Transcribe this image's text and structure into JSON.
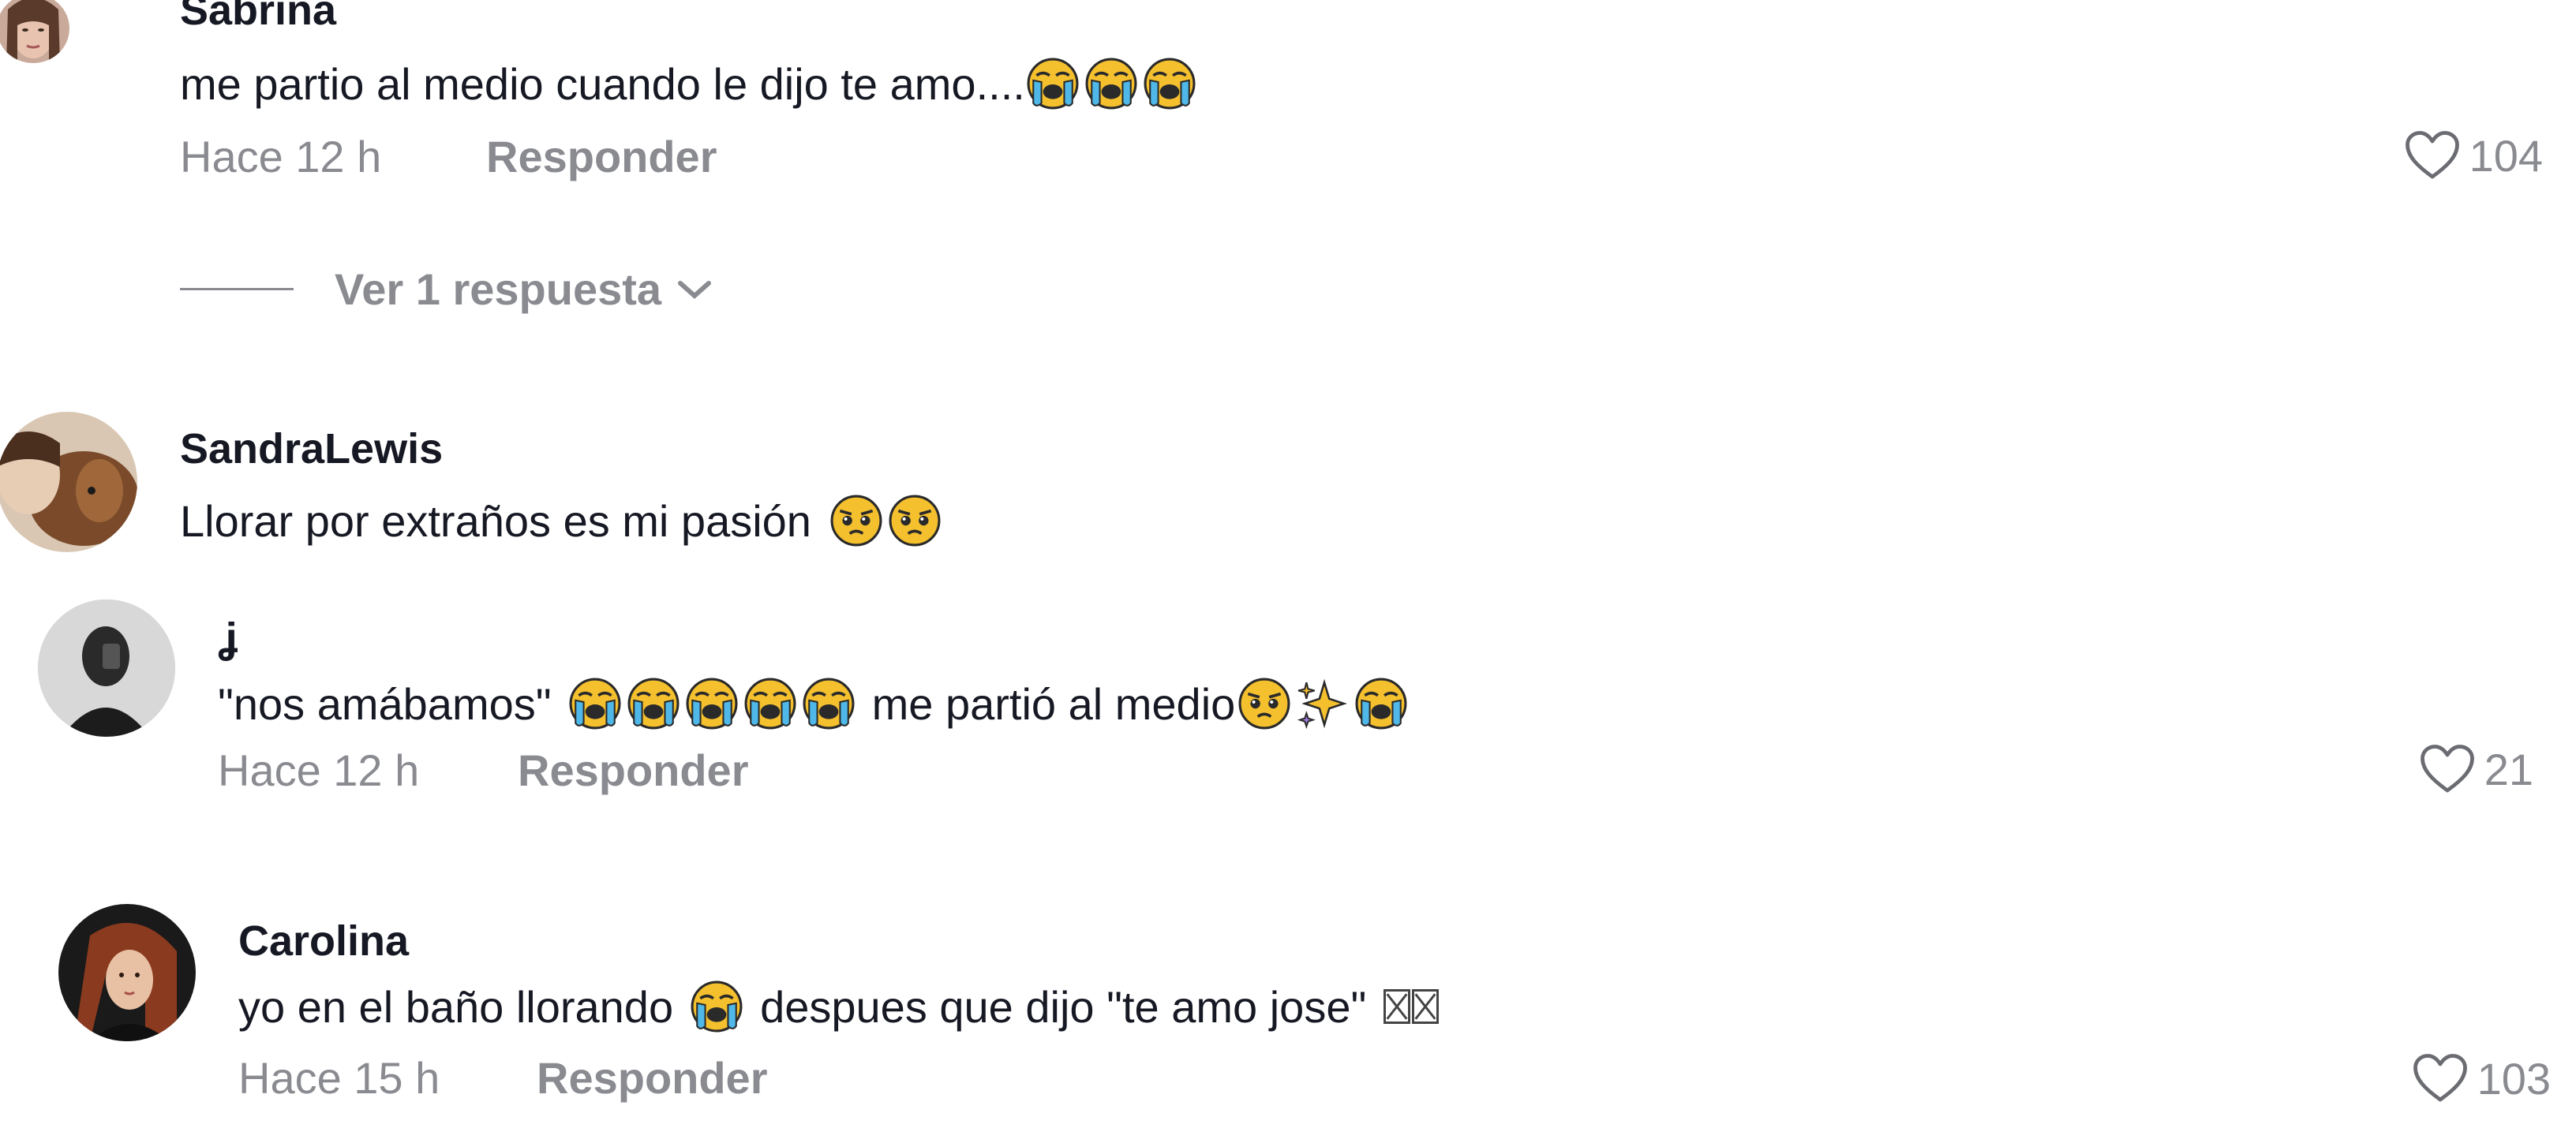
{
  "comments": [
    {
      "username": "Sabrina",
      "text": "me partio al medio cuando le dijo te amo....",
      "emojis": [
        "crying-face",
        "crying-face",
        "crying-face"
      ],
      "time": "Hace 12 h",
      "reply_label": "Responder",
      "likes": "104",
      "view_replies": "Ver 1 respuesta"
    },
    {
      "username": "SandraLewis",
      "text": "Llorar por extraños es mi pasión",
      "emojis": [
        "pleading-face",
        "pleading-face"
      ]
    },
    {
      "username": "ʝ",
      "text_before": "\"nos amábamos\"",
      "text_middle": "me partió al medio",
      "time": "Hace 12 h",
      "reply_label": "Responder",
      "likes": "21"
    },
    {
      "username": "Carolina",
      "text_before": "yo en el baño llorando",
      "text_after": "despues que dijo \"te amo jose\"",
      "time": "Hace 15 h",
      "reply_label": "Responder",
      "likes": "103"
    }
  ],
  "colors": {
    "text": "#161823",
    "secondary": "#8a8b91",
    "emoji_face": "#f5c02e",
    "emoji_tear": "#4fb8e8"
  }
}
